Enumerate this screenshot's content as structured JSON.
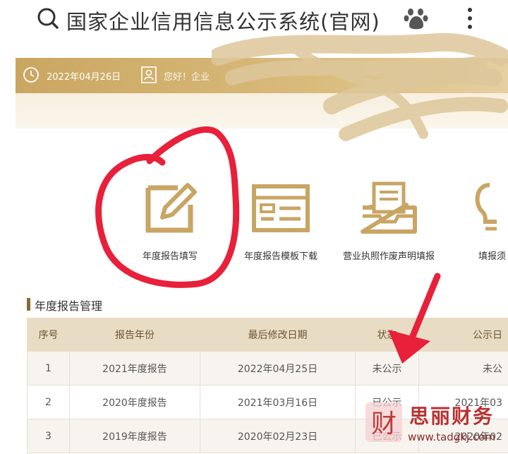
{
  "topbar": {
    "title": "国家企业信用信息公示系统(官网)",
    "icons": [
      "search-icon",
      "paw-icon",
      "more-icon"
    ]
  },
  "header": {
    "date": "2022年04月26日",
    "greeting": "您好！企业"
  },
  "functions": [
    {
      "label": "年度报告填写",
      "icon": "edit-icon"
    },
    {
      "label": "年度报告模板下载",
      "icon": "template-icon"
    },
    {
      "label": "营业执照作废声明填报",
      "icon": "tray-icon"
    },
    {
      "label": "填报须",
      "icon": "bulb-icon"
    }
  ],
  "section": {
    "title": "年度报告管理"
  },
  "table": {
    "headers": [
      "序号",
      "报告年份",
      "最后修改日期",
      "状态",
      "公示日"
    ],
    "rows": [
      [
        "1",
        "2021年度报告",
        "2022年04月25日",
        "未公示",
        "未公"
      ],
      [
        "2",
        "2020年度报告",
        "2021年03月16日",
        "已公示",
        "2021年03"
      ],
      [
        "3",
        "2019年度报告",
        "2020年02月23日",
        "已公示",
        "2020年02"
      ]
    ]
  },
  "watermark": {
    "logo_text": "财",
    "brand": "思丽财务",
    "url": "www.tadgkj.com"
  },
  "colors": {
    "gold": "#caa661",
    "gold_dark": "#b08a45",
    "annotation_red": "#e8203a",
    "brand_red": "#b83232"
  }
}
